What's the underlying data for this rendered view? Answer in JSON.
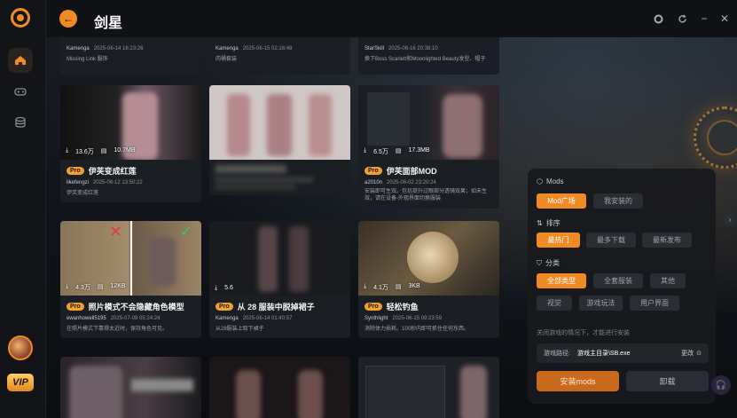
{
  "app": {
    "title": "剑星",
    "vip_label": "VIP"
  },
  "sidebar": {
    "items": [
      {
        "name": "home",
        "icon": "home-icon"
      },
      {
        "name": "games",
        "icon": "gamepad-icon"
      },
      {
        "name": "storage",
        "icon": "database-icon"
      }
    ]
  },
  "top_cards": [
    {
      "author": "Kamenga",
      "date": "2025-06-14 16:23:26",
      "desc": "Missing Link 服饰"
    },
    {
      "author": "Kamenga",
      "date": "2025-06-15 02:16:48",
      "desc": "肉桶套装"
    },
    {
      "author": "StarSkill",
      "date": "2025-06-16 20:38:10",
      "desc": "换下Boss Scarlett和Moonlighted Beauty发型、帽子"
    }
  ],
  "cards": [
    {
      "pro": "Pro",
      "title": "伊芙变成红莲",
      "author": "likefengzi",
      "date": "2025-06-12 13:50:22",
      "desc": "伊芙变成红莲",
      "downloads": "13.6万",
      "size": "10.7MB"
    },
    {
      "pro": "",
      "title": "",
      "author": "",
      "date": "",
      "desc": "",
      "downloads": "",
      "size": ""
    },
    {
      "pro": "Pro",
      "title": "伊芙面部MOD",
      "author": "a2010n",
      "date": "2025-06-02 23:20:24",
      "desc": "安装即可生效。包括提升过眼部分透镜效果；如未生效，请在设备-外观界面切换服装",
      "downloads": "6.5万",
      "size": "17.3MB"
    },
    {
      "pro": "Pro",
      "title": "照片模式不会隐藏角色模型",
      "author": "ewanhowell5195",
      "date": "2025-07-08 05:24:24",
      "desc": "在照片模式下靠得太近时，保持角色可见。",
      "downloads": "4.3万",
      "size": "12KB"
    },
    {
      "pro": "Pro",
      "title": "从 28 服装中脱掉裙子",
      "author": "Kamenga",
      "date": "2025-06-14 01:40:57",
      "desc": "从28服装上取下裙子",
      "downloads": "5.6",
      "size": ""
    },
    {
      "pro": "Pro",
      "title": "轻松钓鱼",
      "author": "Synthlight",
      "date": "2025-06-15 09:23:59",
      "desc": "消除体力损耗。100秒内即可抓住任何东西。",
      "downloads": "4.1万",
      "size": "3KB"
    }
  ],
  "filters": {
    "mods_label": "Mods",
    "mods_tabs": [
      "Mod广场",
      "我安装的"
    ],
    "sort_label": "排序",
    "sort_tabs": [
      "最热门",
      "最多下载",
      "最新发布"
    ],
    "cat_label": "分类",
    "categories": [
      "全部类型",
      "全套服装",
      "其他",
      "视觉",
      "游戏玩法",
      "用户界面"
    ],
    "note": "关闭游戏的情况下，才能进行安装",
    "path_label": "游戏路径:",
    "path_value": "游戏主目录\\SB.exe",
    "change_label": "更改",
    "install_label": "安装mods",
    "uninstall_label": "卸载"
  },
  "colors": {
    "accent": "#f08a24",
    "bg": "#0e1013",
    "card": "#1b1e23"
  }
}
